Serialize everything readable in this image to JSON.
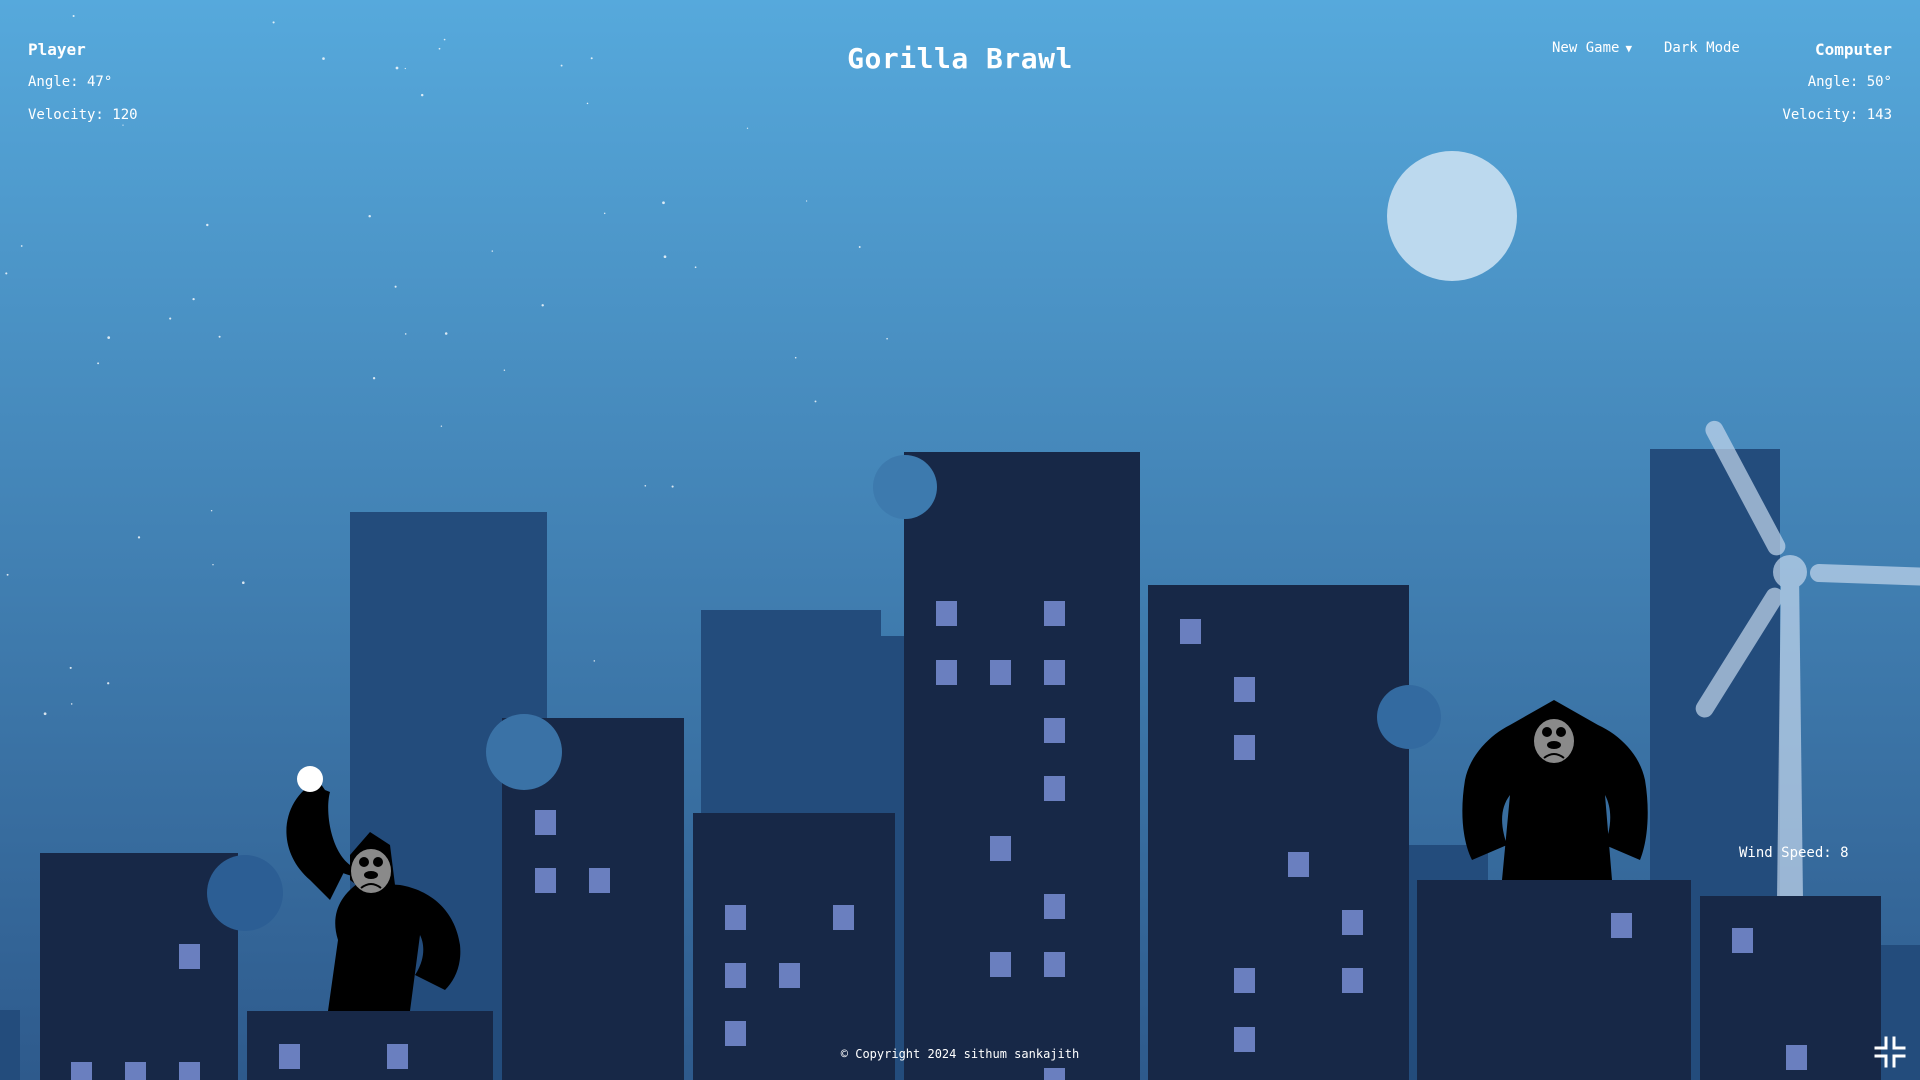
{
  "title": "Gorilla Brawl",
  "player": {
    "name": "Player",
    "angle": "Angle: 47°",
    "velocity": "Velocity: 120"
  },
  "computer": {
    "name": "Computer",
    "angle": "Angle: 50°",
    "velocity": "Velocity: 143"
  },
  "menu": {
    "new_game": "New Game",
    "dark_mode": "Dark Mode"
  },
  "wind": "Wind Speed: 8",
  "copyright": "© Copyright 2024 sithum sankajith",
  "icons": {
    "fullscreen": "exit-fullscreen-icon",
    "dropdown": "caret-down-icon"
  },
  "colors": {
    "sky_top": "#56a9dc",
    "sky_bottom": "#2e5a8c",
    "building_front": "#172847",
    "building_back": "#234c7c",
    "window": "#6a7fbf",
    "moon": "#bcd9ee",
    "turbine": "#c6d8ee"
  }
}
